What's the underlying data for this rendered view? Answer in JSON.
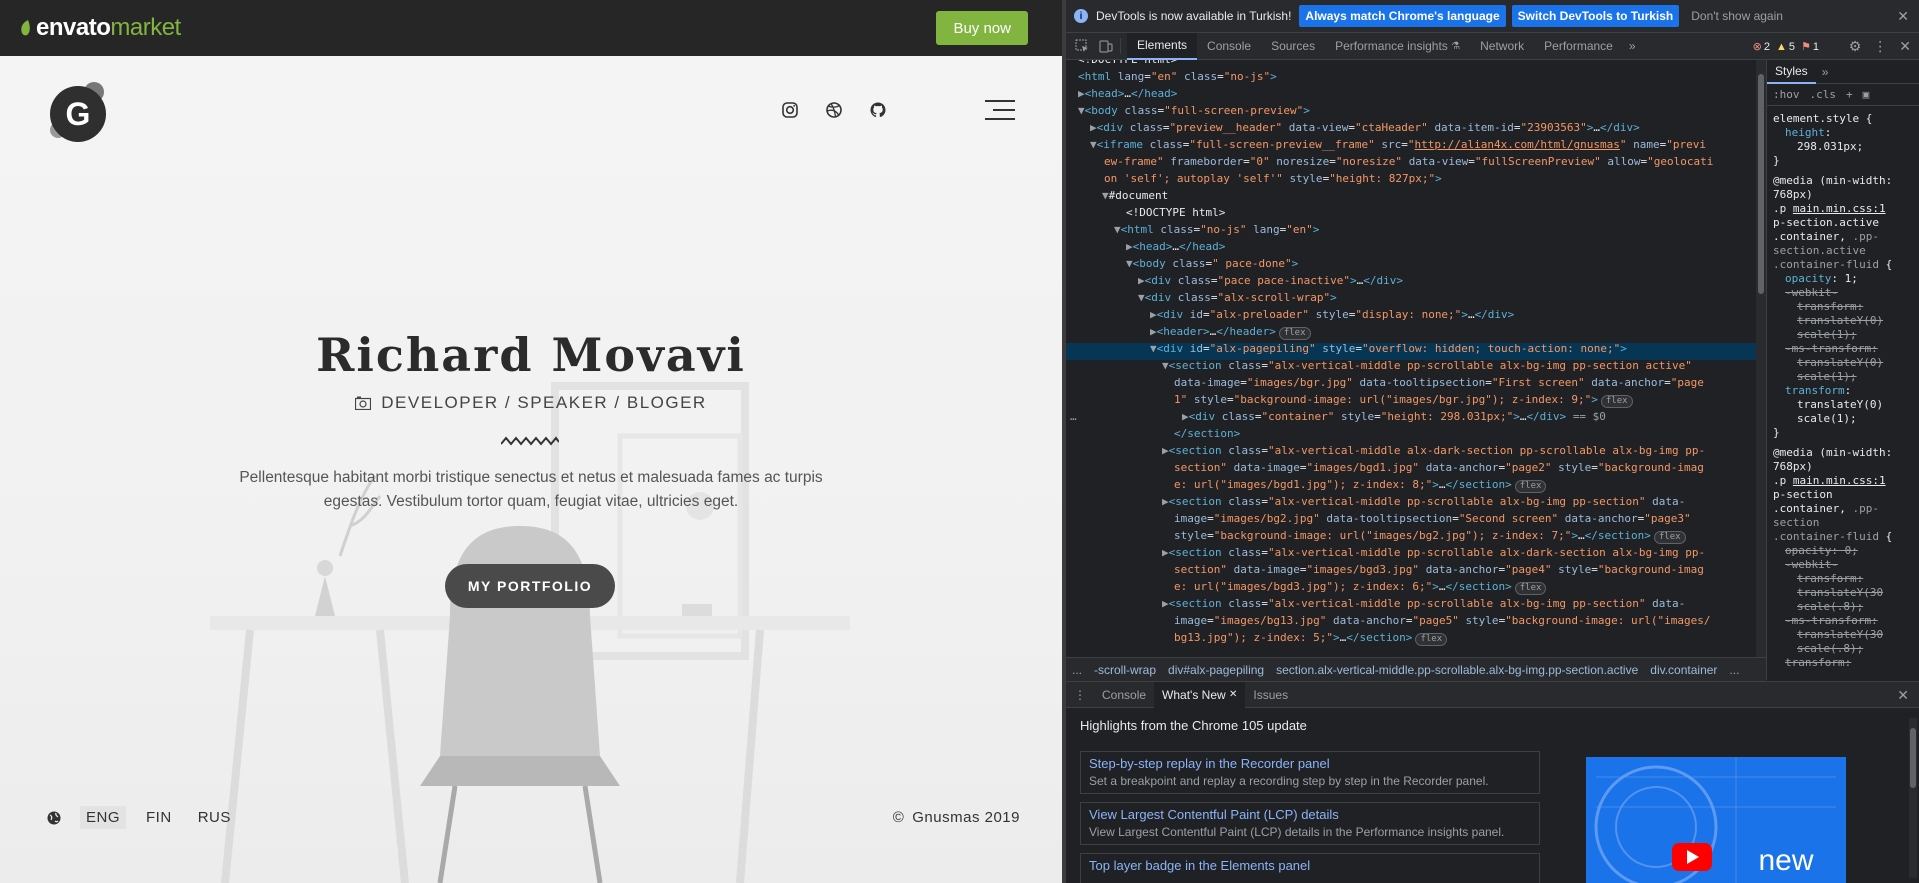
{
  "envato": {
    "brand": "envato",
    "market": "market",
    "buy_now": "Buy now"
  },
  "site": {
    "logo_letter": "G",
    "social_icons": [
      "instagram-icon",
      "dribbble-icon",
      "github-icon"
    ],
    "name": "Richard Movavi",
    "role": "DEVELOPER / SPEAKER / BLOGER",
    "text_line1": "Pellentesque habitant morbi tristique senectus et netus et malesuada fames ac turpis",
    "text_line2": "egestas. Vestibulum tortor quam, feugiat vitae, ultricies eget.",
    "portfolio_button": "MY PORTFOLIO",
    "languages": [
      "ENG",
      "FIN",
      "RUS"
    ],
    "active_language": "ENG",
    "copyright": "Gnusmas 2019"
  },
  "devtools": {
    "infobar": {
      "message": "DevTools is now available in Turkish!",
      "btn_match": "Always match Chrome's language",
      "btn_switch": "Switch DevTools to Turkish",
      "btn_dismiss": "Don't show again"
    },
    "tabs": [
      "Elements",
      "Console",
      "Sources",
      "Performance insights",
      "Network",
      "Performance"
    ],
    "active_tab": "Elements",
    "counts": {
      "errors": "2",
      "warnings": "5",
      "issues": "1"
    },
    "styles_tab": "Styles",
    "styles_filter": [
      ":hov",
      ".cls"
    ],
    "breadcrumbs": [
      "...",
      "-scroll-wrap",
      "div#alx-pagepiling",
      "section.alx-vertical-middle.pp-scrollable.alx-bg-img.pp-section.active",
      "div.container",
      "..."
    ],
    "drawer": {
      "tabs": [
        "Console",
        "What's New",
        "Issues"
      ],
      "active_tab": "What's New",
      "title": "Highlights from the Chrome 105 update",
      "cards": [
        {
          "title": "Step-by-step replay in the Recorder panel",
          "desc": "Set a breakpoint and replay a recording step by step in the Recorder panel."
        },
        {
          "title": "View Largest Contentful Paint (LCP) details",
          "desc": "View Largest Contentful Paint (LCP) details in the Performance insights panel."
        },
        {
          "title": "Top layer badge in the Elements panel",
          "desc": ""
        }
      ],
      "thumb_text": "new"
    }
  }
}
